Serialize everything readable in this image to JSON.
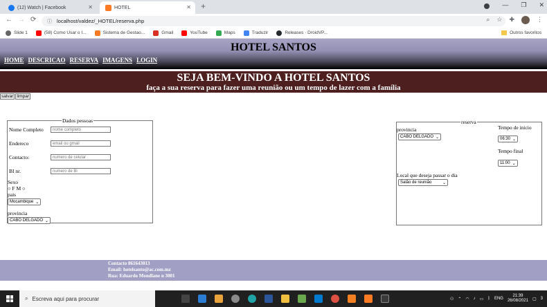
{
  "browser": {
    "tabs": [
      {
        "title": "(12) Watch | Facebook",
        "icon": "facebook-icon",
        "color": "#1877f2"
      },
      {
        "title": "HOTEL",
        "icon": "xampp-icon",
        "color": "#fb7a24"
      }
    ],
    "url": "localhost/valdez/_HOTEL/reserva.php",
    "bookmarks": [
      {
        "label": "Slide 1",
        "icon": "slide-icon",
        "color": "#666666"
      },
      {
        "label": "(58) Como Usar o I...",
        "icon": "youtube-icon",
        "color": "#ff0000"
      },
      {
        "label": "Sistema de Gestao...",
        "icon": "xampp-icon",
        "color": "#fb7a24"
      },
      {
        "label": "Gmail",
        "icon": "gmail-icon",
        "color": "#d93025"
      },
      {
        "label": "YouTube",
        "icon": "youtube-icon",
        "color": "#ff0000"
      },
      {
        "label": "Maps",
        "icon": "maps-icon",
        "color": "#34a853"
      },
      {
        "label": "Traduzir",
        "icon": "translate-icon",
        "color": "#4285f4"
      },
      {
        "label": "Releases · DroidVP...",
        "icon": "github-icon",
        "color": "#24292e"
      }
    ],
    "other_bookmarks": "Outros favoritos"
  },
  "site": {
    "title": "HOTEL SANTOS",
    "menu": [
      "HOME",
      "DESCRICAO",
      "RESERVA",
      "IMAGENS",
      "LOGIN"
    ],
    "banner_title": "SEJA BEM-VINDO A HOTEL SANTOS",
    "banner_subtitle": "faça a sua reserva para fazer uma reunião ou um tempo de lazer com a família",
    "buttons": {
      "save": "salvar",
      "clear": "limpar"
    }
  },
  "personal": {
    "legend": "Dados pessoas",
    "name_label": "Nome Completo",
    "name_placeholder": "nome completo",
    "address_label": "Endereco",
    "address_placeholder": "email ou gmail",
    "contact_label": "Contacto:",
    "contact_placeholder": "numero de celular",
    "bi_label": "BI nr.",
    "bi_placeholder": "numero de Bi",
    "sex_label": "Sexo",
    "sex_options": "F M",
    "country_label": "pais",
    "country_value": "Mocambique",
    "province_label": "provincia",
    "province_value": "CABO DELGADO"
  },
  "reservation": {
    "legend": "reserva",
    "province_label": "provincia",
    "province_value": "CABO DELGADO",
    "start_label": "Tempo de inicio",
    "start_value": "06:30",
    "end_label": "Tempo final",
    "end_value": "11:00",
    "place_label": "Local que deseja passar o dia",
    "place_value": "Salão de reunião"
  },
  "footer": {
    "contact": "Contacto 861643013",
    "email": "Email: hotelsanto@ac.com.mz",
    "address": "Rua: Eduardo Mondlane n 3001"
  },
  "taskbar": {
    "search_placeholder": "Escreva aqui para procurar",
    "lang": "ENG",
    "time": "21:39",
    "date": "26/08/2021",
    "notifications": "3"
  }
}
